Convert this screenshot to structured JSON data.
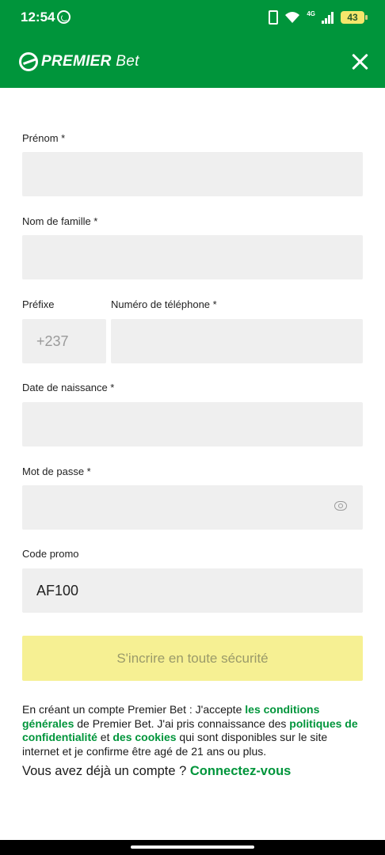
{
  "status_bar": {
    "time": "12:54",
    "network": "4G",
    "battery": "43"
  },
  "header": {
    "brand_bold": "PREMIER",
    "brand_light": "Bet"
  },
  "form": {
    "first_name_label": "Prénom *",
    "last_name_label": "Nom de famille *",
    "prefix_label": "Préfixe",
    "prefix_value": "+237",
    "phone_label": "Numéro de téléphone *",
    "birthdate_label": "Date de naissance *",
    "password_label": "Mot de passe *",
    "promo_label": "Code promo",
    "promo_value": "AF100",
    "submit_label": "S'incrire en toute sécurité"
  },
  "terms": {
    "t1": "En créant un compte Premier Bet : J'accepte ",
    "link1": "les conditions générales",
    "t2": " de Premier Bet. J'ai pris connaissance des ",
    "link2": "politiques de confidentialité",
    "t3": " et ",
    "link3": "des cookies",
    "t4": " qui sont disponibles sur le site internet et je confirme être agé de 21 ans ou plus."
  },
  "login": {
    "text": "Vous avez déjà un compte ? ",
    "link": "Connectez-vous"
  },
  "colors": {
    "brand_green": "#00953b",
    "submit_bg": "#f6f093",
    "field_bg": "#efefef"
  }
}
